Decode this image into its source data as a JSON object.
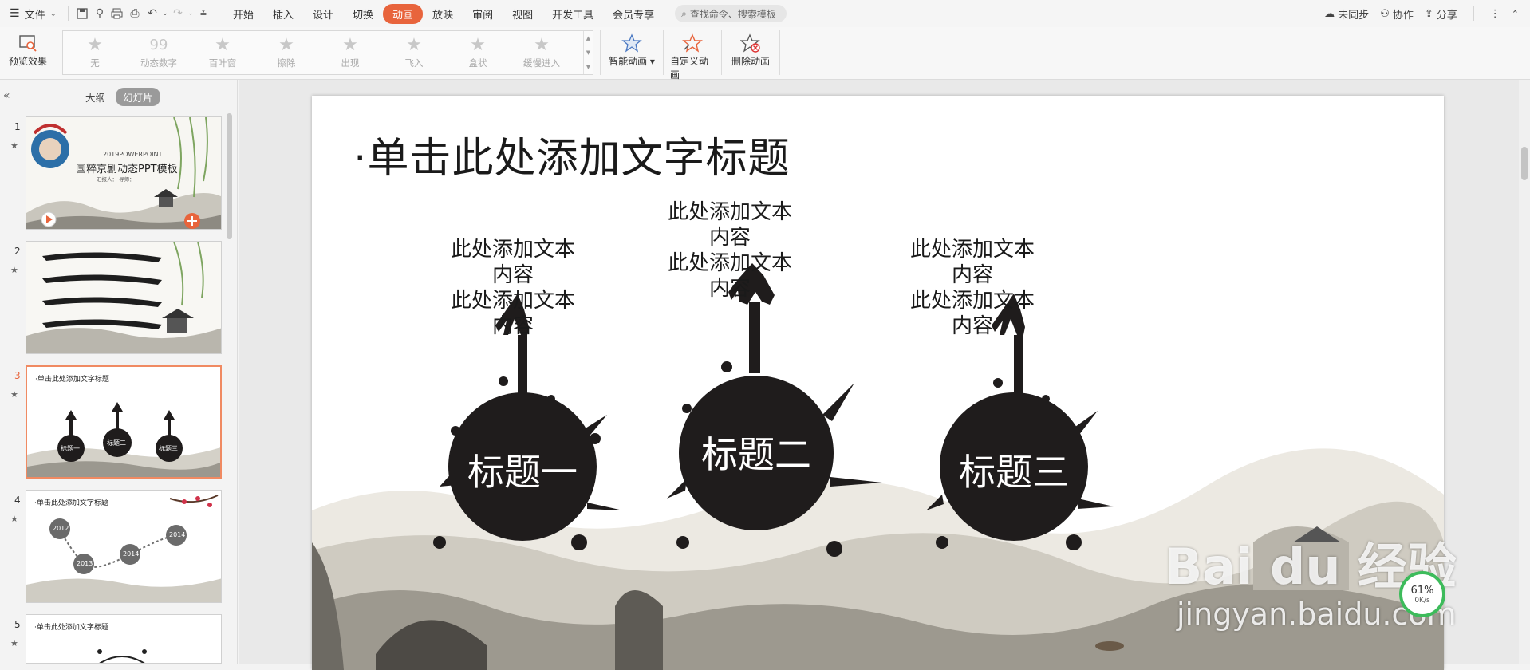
{
  "menubar": {
    "file_label": "文件",
    "tabs": [
      "开始",
      "插入",
      "设计",
      "切换",
      "动画",
      "放映",
      "审阅",
      "视图",
      "开发工具",
      "会员专享"
    ],
    "active_tab": "动画",
    "search_placeholder": "查找命令、搜索模板",
    "sync_label": "未同步",
    "collab_label": "协作",
    "share_label": "分享"
  },
  "ribbon": {
    "preview_label": "预览效果",
    "gallery": [
      "无",
      "动态数字",
      "百叶窗",
      "擦除",
      "出现",
      "飞入",
      "盒状",
      "缓慢进入"
    ],
    "smart_anim_label": "智能动画",
    "custom_anim_label": "自定义动画",
    "delete_anim_label": "删除动画"
  },
  "leftpane": {
    "outline_tab": "大纲",
    "slides_tab": "幻灯片",
    "slides": [
      {
        "num": "1",
        "title": "国粹京剧动态PPT模板",
        "subtitle": "2019POWERPOINT",
        "reporter": "汇报人：   导师："
      },
      {
        "num": "2"
      },
      {
        "num": "3",
        "title": "·单击此处添加文字标题",
        "labels": [
          "标题一",
          "标题二",
          "标题三"
        ]
      },
      {
        "num": "4",
        "title": "·单击此处添加文字标题",
        "years": [
          "2012",
          "2013",
          "2014",
          "2014"
        ]
      },
      {
        "num": "5",
        "title": "·单击此处添加文字标题"
      }
    ],
    "current_slide": "3"
  },
  "slide": {
    "title": "·单击此处添加文字标题",
    "texts": [
      {
        "line1": "此处添加文本内容",
        "line2": "此处添加文本内容"
      },
      {
        "line1": "此处添加文本内容",
        "line2": "此处添加文本内容"
      },
      {
        "line1": "此处添加文本内容",
        "line2": "此处添加文本内容"
      }
    ],
    "blob_labels": [
      "标题一",
      "标题二",
      "标题三"
    ]
  },
  "watermark": {
    "brand": "Bai du 经验",
    "url": "jingyan.baidu.com",
    "speed_pct": "61%",
    "speed_rate": "0K/s"
  },
  "colors": {
    "accent": "#e8643c",
    "ink": "#1f1c1c"
  }
}
